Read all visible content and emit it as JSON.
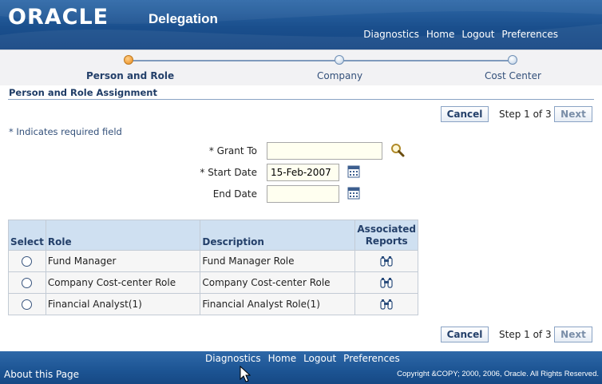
{
  "header": {
    "logo_text": "ORACLE",
    "app_title": "Delegation",
    "global_links": [
      "Diagnostics",
      "Home",
      "Logout",
      "Preferences"
    ]
  },
  "train": {
    "steps": [
      "Person and Role",
      "Company",
      "Cost Center"
    ],
    "active_index": 0
  },
  "section": {
    "title": "Person and Role Assignment"
  },
  "nav": {
    "cancel_label": "Cancel",
    "step_text": "Step 1 of 3",
    "next_label": "Next"
  },
  "form": {
    "required_hint": "* Indicates required field",
    "grant_to": {
      "label": "* Grant To",
      "value": ""
    },
    "start_date": {
      "label": "* Start Date",
      "value": "15-Feb-2007"
    },
    "end_date": {
      "label": "End Date",
      "value": ""
    }
  },
  "table": {
    "headers": {
      "select": "Select",
      "role": "Role",
      "description": "Description",
      "reports_line1": "Associated",
      "reports_line2": "Reports"
    },
    "rows": [
      {
        "role": "Fund Manager",
        "description": "Fund Manager Role"
      },
      {
        "role": "Company Cost-center Role",
        "description": "Company Cost-center Role"
      },
      {
        "role": "Financial Analyst(1)",
        "description": "Financial Analyst Role(1)"
      }
    ]
  },
  "footer": {
    "links": [
      "Diagnostics",
      "Home",
      "Logout",
      "Preferences"
    ],
    "about": "About this Page",
    "copyright": "Copyright &COPY; 2000, 2006, Oracle. All Rights Reserved."
  },
  "colors": {
    "header_blue": "#1a4f8d",
    "train_active": "#f2a545",
    "table_header": "#cfe0f1"
  },
  "icons": {
    "search": "search-icon",
    "calendar": "calendar-icon",
    "reports": "binoculars-icon",
    "cursor": "mouse-pointer-icon"
  }
}
